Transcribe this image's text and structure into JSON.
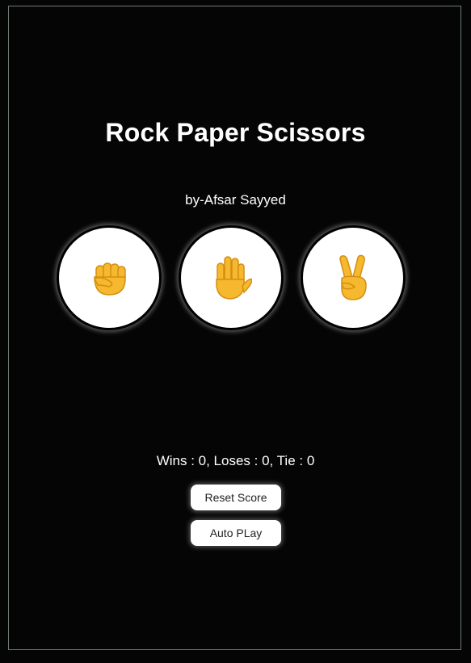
{
  "game": {
    "title": "Rock Paper Scissors",
    "author": "by-Afsar Sayyed",
    "choices": [
      {
        "name": "rock",
        "icon": "raised-fist-icon"
      },
      {
        "name": "paper",
        "icon": "raised-hand-icon"
      },
      {
        "name": "scissors",
        "icon": "victory-hand-icon"
      }
    ],
    "score_text": "Wins : 0, Loses : 0, Tie : 0",
    "score": {
      "wins": 0,
      "loses": 0,
      "tie": 0
    },
    "reset_label": "Reset Score",
    "autoplay_label": "Auto PLay"
  },
  "colors": {
    "background": "#050505",
    "frame_border": "#6f7a70",
    "emoji": "#f5b82e",
    "button_bg": "#ffffff"
  }
}
